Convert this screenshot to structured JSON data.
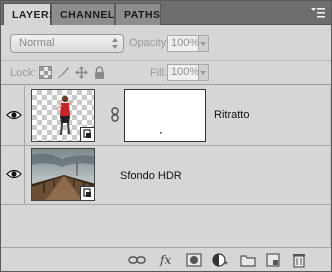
{
  "tabs": [
    {
      "label": "LAYERS",
      "active": true
    },
    {
      "label": "CHANNELS",
      "active": false
    },
    {
      "label": "PATHS",
      "active": false
    }
  ],
  "blend": {
    "mode": "Normal"
  },
  "opacity": {
    "label": "Opacity:",
    "value": "100%"
  },
  "lock": {
    "label": "Lock:"
  },
  "fill": {
    "label": "Fill:",
    "value": "100%"
  },
  "layers": [
    {
      "name": "Ritratto",
      "visible": true,
      "has_mask": true,
      "smart_object": true
    },
    {
      "name": "Sfondo HDR",
      "visible": true,
      "has_mask": false,
      "smart_object": true
    }
  ],
  "bottom_icons": [
    "link-layers-icon",
    "fx-icon",
    "add-mask-icon",
    "adjustment-layer-icon",
    "new-group-icon",
    "new-layer-icon",
    "trash-icon"
  ],
  "colors": {
    "panel_bg": "#d6d6d6",
    "tab_bar": "#6e6e6e",
    "disabled_text": "#9a9a9a"
  }
}
